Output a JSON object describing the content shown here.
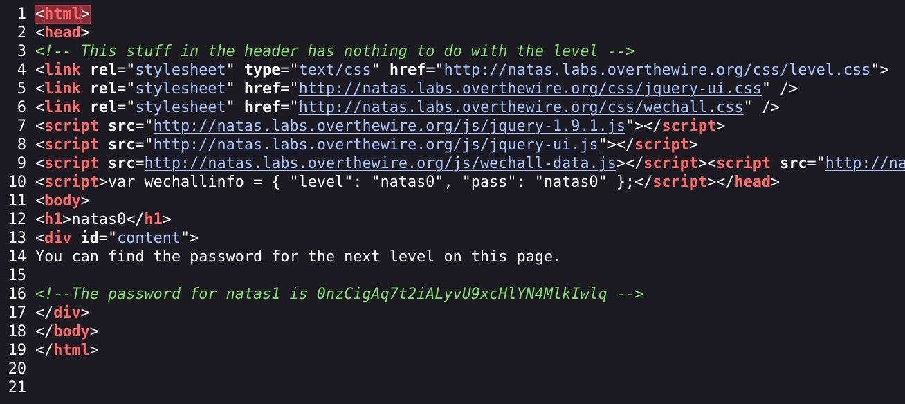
{
  "viewer": {
    "type": "view-source",
    "colors": {
      "background": "#1c1b22",
      "text": "#fbfbfe",
      "tag": "#ff6b6b",
      "attribute_value": "#a8c5ff",
      "comment": "#86de74",
      "highlight": "#8a2c36"
    }
  },
  "lines": [
    {
      "n": "1",
      "tokens": [
        {
          "t": "<",
          "c": "plain",
          "hl": true
        },
        {
          "t": "html",
          "c": "tag",
          "hl": true
        },
        {
          "t": ">",
          "c": "plain",
          "hl": true
        }
      ]
    },
    {
      "n": "2",
      "tokens": [
        {
          "t": "<",
          "c": "plain"
        },
        {
          "t": "head",
          "c": "tag"
        },
        {
          "t": ">",
          "c": "plain"
        }
      ]
    },
    {
      "n": "3",
      "tokens": [
        {
          "t": "<!-- This stuff in the header has nothing to do with the level -->",
          "c": "comment"
        }
      ]
    },
    {
      "n": "4",
      "tokens": [
        {
          "t": "<",
          "c": "plain"
        },
        {
          "t": "link",
          "c": "tag"
        },
        {
          "t": " ",
          "c": "plain"
        },
        {
          "t": "rel",
          "c": "attr"
        },
        {
          "t": "=\"",
          "c": "plain"
        },
        {
          "t": "stylesheet",
          "c": "val"
        },
        {
          "t": "\" ",
          "c": "plain"
        },
        {
          "t": "type",
          "c": "attr"
        },
        {
          "t": "=\"",
          "c": "plain"
        },
        {
          "t": "text/css",
          "c": "val"
        },
        {
          "t": "\" ",
          "c": "plain"
        },
        {
          "t": "href",
          "c": "attr"
        },
        {
          "t": "=\"",
          "c": "plain"
        },
        {
          "t": "http://natas.labs.overthewire.org/css/level.css",
          "c": "link"
        },
        {
          "t": "\">",
          "c": "plain"
        }
      ]
    },
    {
      "n": "5",
      "tokens": [
        {
          "t": "<",
          "c": "plain"
        },
        {
          "t": "link",
          "c": "tag"
        },
        {
          "t": " ",
          "c": "plain"
        },
        {
          "t": "rel",
          "c": "attr"
        },
        {
          "t": "=\"",
          "c": "plain"
        },
        {
          "t": "stylesheet",
          "c": "val"
        },
        {
          "t": "\" ",
          "c": "plain"
        },
        {
          "t": "href",
          "c": "attr"
        },
        {
          "t": "=\"",
          "c": "plain"
        },
        {
          "t": "http://natas.labs.overthewire.org/css/jquery-ui.css",
          "c": "link"
        },
        {
          "t": "\" />",
          "c": "plain"
        }
      ]
    },
    {
      "n": "6",
      "tokens": [
        {
          "t": "<",
          "c": "plain"
        },
        {
          "t": "link",
          "c": "tag"
        },
        {
          "t": " ",
          "c": "plain"
        },
        {
          "t": "rel",
          "c": "attr"
        },
        {
          "t": "=\"",
          "c": "plain"
        },
        {
          "t": "stylesheet",
          "c": "val"
        },
        {
          "t": "\" ",
          "c": "plain"
        },
        {
          "t": "href",
          "c": "attr"
        },
        {
          "t": "=\"",
          "c": "plain"
        },
        {
          "t": "http://natas.labs.overthewire.org/css/wechall.css",
          "c": "link"
        },
        {
          "t": "\" />",
          "c": "plain"
        }
      ]
    },
    {
      "n": "7",
      "tokens": [
        {
          "t": "<",
          "c": "plain"
        },
        {
          "t": "script",
          "c": "tag"
        },
        {
          "t": " ",
          "c": "plain"
        },
        {
          "t": "src",
          "c": "attr"
        },
        {
          "t": "=\"",
          "c": "plain"
        },
        {
          "t": "http://natas.labs.overthewire.org/js/jquery-1.9.1.js",
          "c": "link"
        },
        {
          "t": "\"></",
          "c": "plain"
        },
        {
          "t": "script",
          "c": "tag"
        },
        {
          "t": ">",
          "c": "plain"
        }
      ]
    },
    {
      "n": "8",
      "tokens": [
        {
          "t": "<",
          "c": "plain"
        },
        {
          "t": "script",
          "c": "tag"
        },
        {
          "t": " ",
          "c": "plain"
        },
        {
          "t": "src",
          "c": "attr"
        },
        {
          "t": "=\"",
          "c": "plain"
        },
        {
          "t": "http://natas.labs.overthewire.org/js/jquery-ui.js",
          "c": "link"
        },
        {
          "t": "\"></",
          "c": "plain"
        },
        {
          "t": "script",
          "c": "tag"
        },
        {
          "t": ">",
          "c": "plain"
        }
      ]
    },
    {
      "n": "9",
      "tokens": [
        {
          "t": "<",
          "c": "plain"
        },
        {
          "t": "script",
          "c": "tag"
        },
        {
          "t": " ",
          "c": "plain"
        },
        {
          "t": "src",
          "c": "attr"
        },
        {
          "t": "=",
          "c": "plain"
        },
        {
          "t": "http://natas.labs.overthewire.org/js/wechall-data.js",
          "c": "link"
        },
        {
          "t": "></",
          "c": "plain"
        },
        {
          "t": "script",
          "c": "tag"
        },
        {
          "t": "><",
          "c": "plain"
        },
        {
          "t": "script",
          "c": "tag"
        },
        {
          "t": " ",
          "c": "plain"
        },
        {
          "t": "src",
          "c": "attr"
        },
        {
          "t": "=\"",
          "c": "plain"
        },
        {
          "t": "http://na",
          "c": "link"
        }
      ]
    },
    {
      "n": "10",
      "tokens": [
        {
          "t": "<",
          "c": "plain"
        },
        {
          "t": "script",
          "c": "tag"
        },
        {
          "t": ">var wechallinfo = { \"level\": \"natas0\", \"pass\": \"natas0\" };</",
          "c": "plain"
        },
        {
          "t": "script",
          "c": "tag"
        },
        {
          "t": "></",
          "c": "plain"
        },
        {
          "t": "head",
          "c": "tag"
        },
        {
          "t": ">",
          "c": "plain"
        }
      ]
    },
    {
      "n": "11",
      "tokens": [
        {
          "t": "<",
          "c": "plain"
        },
        {
          "t": "body",
          "c": "tag"
        },
        {
          "t": ">",
          "c": "plain"
        }
      ]
    },
    {
      "n": "12",
      "tokens": [
        {
          "t": "<",
          "c": "plain"
        },
        {
          "t": "h1",
          "c": "tag"
        },
        {
          "t": ">natas0</",
          "c": "plain"
        },
        {
          "t": "h1",
          "c": "tag"
        },
        {
          "t": ">",
          "c": "plain"
        }
      ]
    },
    {
      "n": "13",
      "tokens": [
        {
          "t": "<",
          "c": "plain"
        },
        {
          "t": "div",
          "c": "tag"
        },
        {
          "t": " ",
          "c": "plain"
        },
        {
          "t": "id",
          "c": "attr"
        },
        {
          "t": "=\"",
          "c": "plain"
        },
        {
          "t": "content",
          "c": "val"
        },
        {
          "t": "\">",
          "c": "plain"
        }
      ]
    },
    {
      "n": "14",
      "tokens": [
        {
          "t": "You can find the password for the next level on this page.",
          "c": "plain"
        }
      ]
    },
    {
      "n": "15",
      "tokens": []
    },
    {
      "n": "16",
      "tokens": [
        {
          "t": "<!--The password for natas1 is 0nzCigAq7t2iALyvU9xcHlYN4MlkIwlq -->",
          "c": "comment"
        }
      ]
    },
    {
      "n": "17",
      "tokens": [
        {
          "t": "</",
          "c": "plain"
        },
        {
          "t": "div",
          "c": "tag"
        },
        {
          "t": ">",
          "c": "plain"
        }
      ]
    },
    {
      "n": "18",
      "tokens": [
        {
          "t": "</",
          "c": "plain"
        },
        {
          "t": "body",
          "c": "tag"
        },
        {
          "t": ">",
          "c": "plain"
        }
      ]
    },
    {
      "n": "19",
      "tokens": [
        {
          "t": "</",
          "c": "plain"
        },
        {
          "t": "html",
          "c": "tag"
        },
        {
          "t": ">",
          "c": "plain"
        }
      ]
    },
    {
      "n": "20",
      "tokens": []
    },
    {
      "n": "21",
      "tokens": []
    }
  ]
}
